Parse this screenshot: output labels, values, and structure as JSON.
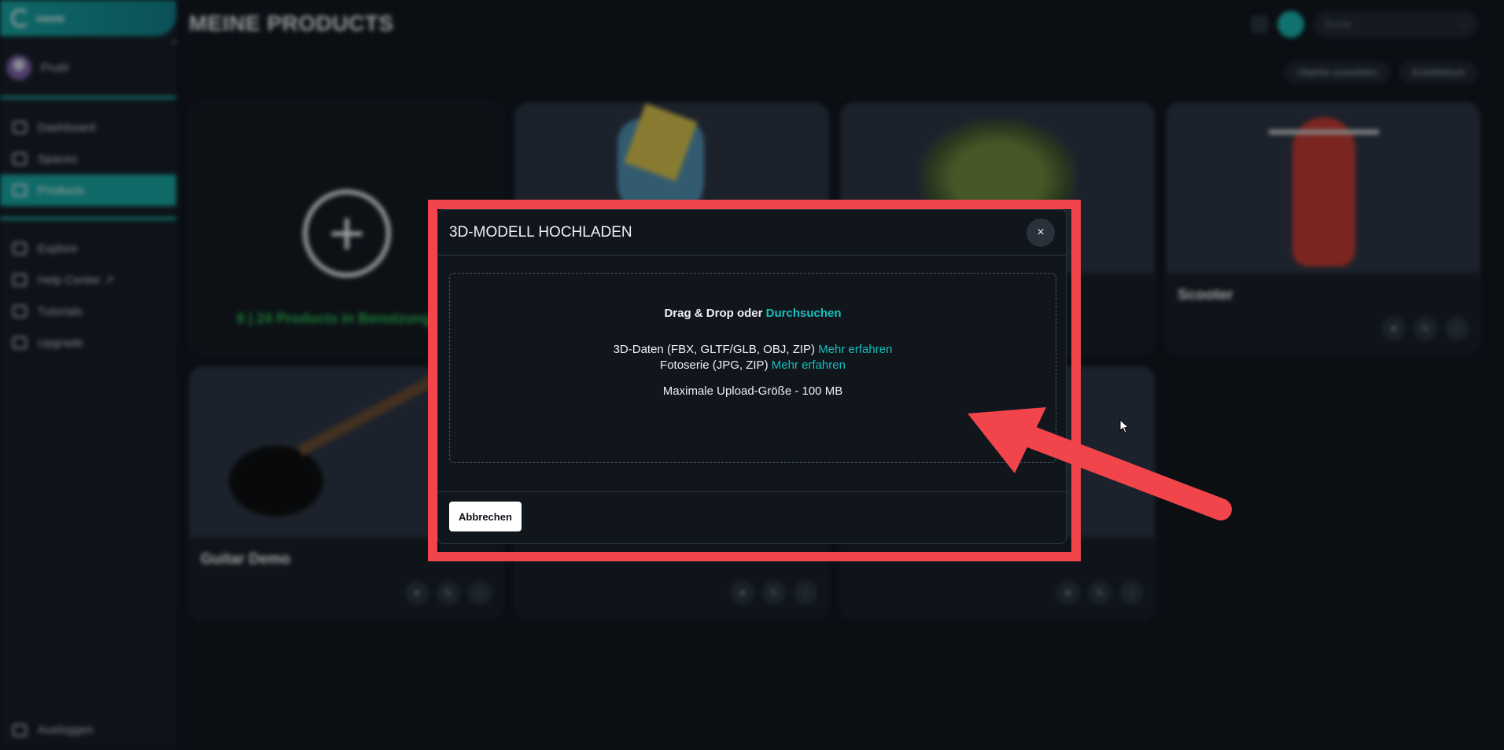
{
  "sidebar": {
    "brand": "vasm",
    "user": "Pruhl",
    "items": [
      {
        "label": "Dashboard",
        "icon": "home-icon"
      },
      {
        "label": "Spaces",
        "icon": "spaces-icon"
      },
      {
        "label": "Products",
        "icon": "products-icon",
        "active": true
      },
      {
        "label": "Explore",
        "icon": "explore-icon"
      },
      {
        "label": "Help Center ↗",
        "icon": "help-icon"
      },
      {
        "label": "Tutorials",
        "icon": "tutorials-icon"
      },
      {
        "label": "Upgrade",
        "icon": "upgrade-icon"
      }
    ],
    "logout": "Ausloggen"
  },
  "header": {
    "title": "MEINE PRODUCTS",
    "search_placeholder": "Suche",
    "select_label": "Objekte auswählen",
    "sort_label": "Erstelldatum"
  },
  "cards": {
    "add_text": "6 | 24 Products in Benutzung",
    "scooter": "Scooter",
    "guitar": "Guitar Demo"
  },
  "modal": {
    "title": "3D-MODELL HOCHLADEN",
    "close": "×",
    "drag_text": "Drag & Drop oder ",
    "browse": "Durchsuchen",
    "formats_3d": "3D-Daten (FBX, GLTF/GLB, OBJ, ZIP) ",
    "formats_photo": "Fotoserie (JPG, ZIP) ",
    "learn_more": "Mehr erfahren",
    "max_size": "Maximale Upload-Größe - 100 MB",
    "cancel": "Abbrechen"
  },
  "colors": {
    "accent": "#16a6a1",
    "highlight": "#f1444b",
    "background": "#0f141b"
  }
}
